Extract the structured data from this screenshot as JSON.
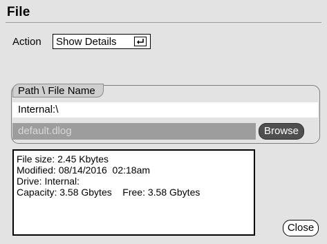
{
  "window": {
    "title": "File"
  },
  "action": {
    "label": "Action",
    "selected": "Show Details",
    "enter_icon": "enter-key-icon"
  },
  "path_group": {
    "label": "Path \\ File Name",
    "path": "Internal:\\",
    "filename": "default.dlog",
    "browse_label": "Browse"
  },
  "details": {
    "file_size": "File size: 2.45 Kbytes",
    "modified": "Modified: 08/14/2016  02:18am",
    "drive": "Drive: Internal:",
    "capacity": "Capacity: 3.58 Gbytes    Free: 3.58 Gbytes"
  },
  "buttons": {
    "close_label": "Close"
  },
  "colors": {
    "background": "#e3e3e3",
    "browse_button": "#4f4f4f",
    "filename_field": "#9d9d9d"
  }
}
